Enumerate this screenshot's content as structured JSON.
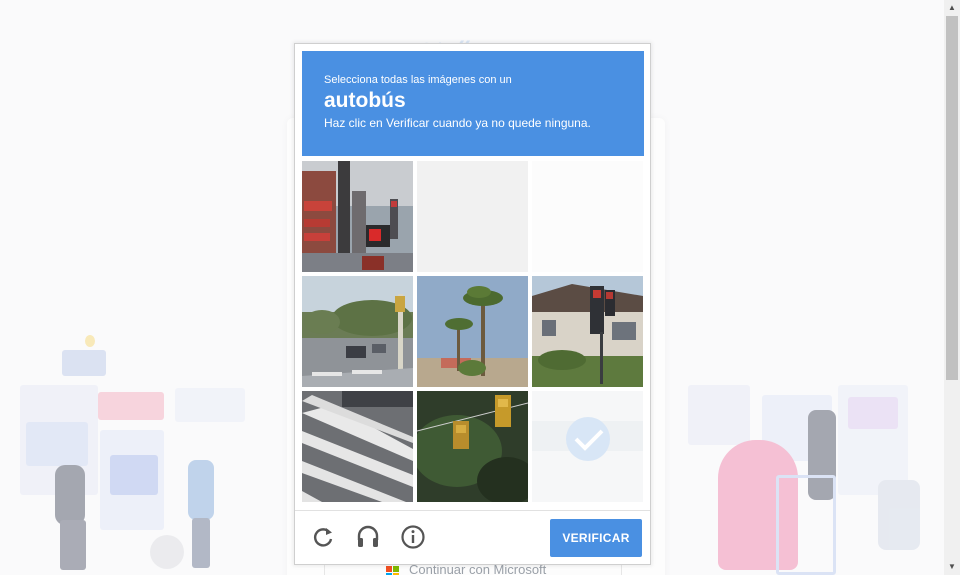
{
  "background_page": {
    "continue_microsoft_label": "Continuar con Microsoft"
  },
  "captcha": {
    "instruction_line1": "Selecciona todas las imágenes con un",
    "target_object": "autobús",
    "instruction_line2": "Haz clic en Verificar cuando ya no quede ninguna.",
    "verify_label": "VERIFICAR",
    "footer_icons": [
      "reload-icon",
      "audio-headphones-icon",
      "info-icon"
    ],
    "accent_color": "#4a90e2",
    "tiles": [
      {
        "name": "tile-storefront-traffic-light",
        "state": "unselected"
      },
      {
        "name": "tile-blank-fading",
        "state": "fading"
      },
      {
        "name": "tile-blank-fading",
        "state": "fading"
      },
      {
        "name": "tile-street-traffic-signal",
        "state": "unselected"
      },
      {
        "name": "tile-palm-trees",
        "state": "unselected"
      },
      {
        "name": "tile-building-traffic-lights",
        "state": "unselected"
      },
      {
        "name": "tile-crosswalk",
        "state": "unselected"
      },
      {
        "name": "tile-hanging-traffic-lights",
        "state": "unselected"
      },
      {
        "name": "tile-selected-fading",
        "state": "selected"
      }
    ]
  }
}
